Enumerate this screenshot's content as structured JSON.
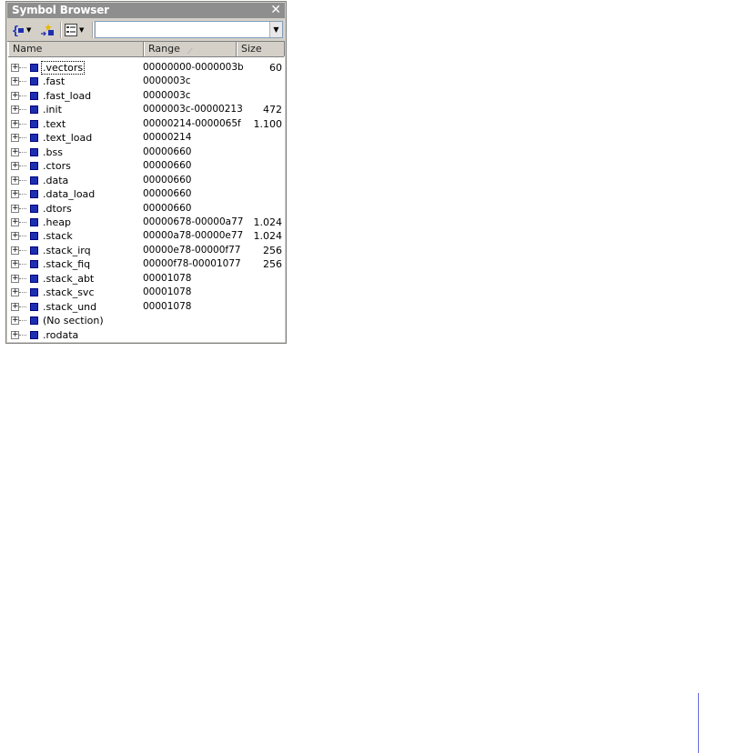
{
  "window": {
    "title": "Symbol Browser",
    "close_glyph": "✕"
  },
  "toolbar": {
    "buttons": [
      "braces-scope-icon",
      "new-symbol-icon",
      "view-options-icon"
    ],
    "combo_value": "",
    "combo_arrow": "▼"
  },
  "columns": {
    "name": "Name",
    "range": "Range",
    "size": "Size",
    "sort_glyph": "⟋"
  },
  "rows": [
    {
      "name": ".vectors",
      "range": "00000000-0000003b",
      "size": "60"
    },
    {
      "name": ".fast",
      "range": "0000003c",
      "size": ""
    },
    {
      "name": ".fast_load",
      "range": "0000003c",
      "size": ""
    },
    {
      "name": ".init",
      "range": "0000003c-00000213",
      "size": "472"
    },
    {
      "name": ".text",
      "range": "00000214-0000065f",
      "size": "1.100"
    },
    {
      "name": ".text_load",
      "range": "00000214",
      "size": ""
    },
    {
      "name": ".bss",
      "range": "00000660",
      "size": ""
    },
    {
      "name": ".ctors",
      "range": "00000660",
      "size": ""
    },
    {
      "name": ".data",
      "range": "00000660",
      "size": ""
    },
    {
      "name": ".data_load",
      "range": "00000660",
      "size": ""
    },
    {
      "name": ".dtors",
      "range": "00000660",
      "size": ""
    },
    {
      "name": ".heap",
      "range": "00000678-00000a77",
      "size": "1.024"
    },
    {
      "name": ".stack",
      "range": "00000a78-00000e77",
      "size": "1.024"
    },
    {
      "name": ".stack_irq",
      "range": "00000e78-00000f77",
      "size": "256"
    },
    {
      "name": ".stack_fiq",
      "range": "00000f78-00001077",
      "size": "256"
    },
    {
      "name": ".stack_abt",
      "range": "00001078",
      "size": ""
    },
    {
      "name": ".stack_svc",
      "range": "00001078",
      "size": ""
    },
    {
      "name": ".stack_und",
      "range": "00001078",
      "size": ""
    },
    {
      "name": "(No section)",
      "range": "",
      "size": ""
    },
    {
      "name": ".rodata",
      "range": "",
      "size": ""
    }
  ],
  "colors": {
    "section_icon": "#1c2fb0",
    "title_bar": "#8e8e8e",
    "panel": "#d4d0c8"
  }
}
